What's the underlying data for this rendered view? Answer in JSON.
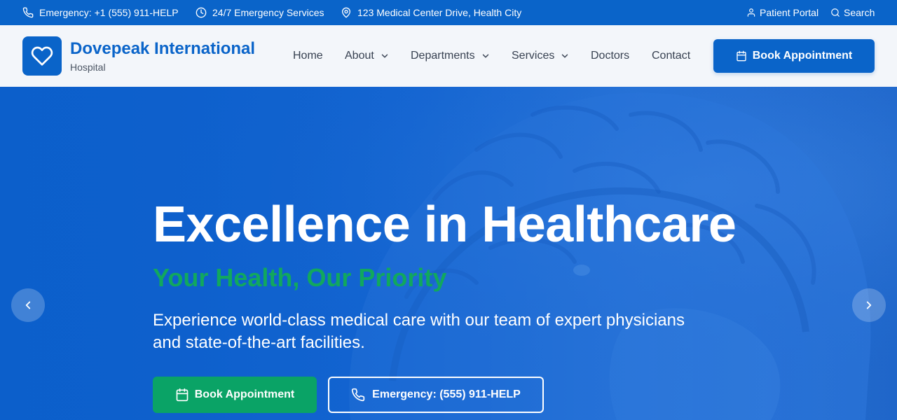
{
  "colors": {
    "primary": "#0a64c9",
    "accent_green": "#0aa366",
    "tagline_green": "#11a85e"
  },
  "topbar": {
    "emergency": {
      "icon": "phone-icon",
      "text": "Emergency: +1 (555) 911-HELP"
    },
    "hours": {
      "icon": "clock-icon",
      "text": "24/7 Emergency Services"
    },
    "address": {
      "icon": "map-pin-icon",
      "text": "123 Medical Center Drive, Health City"
    },
    "patient_portal": {
      "icon": "user-icon",
      "text": "Patient Portal"
    },
    "search": {
      "icon": "search-icon",
      "text": "Search"
    }
  },
  "header": {
    "logo_icon": "heart-icon",
    "brand_name": "Dovepeak International",
    "brand_sub": "Hospital",
    "nav": [
      {
        "label": "Home",
        "dropdown": false
      },
      {
        "label": "About",
        "dropdown": true
      },
      {
        "label": "Departments",
        "dropdown": true
      },
      {
        "label": "Services",
        "dropdown": true
      },
      {
        "label": "Doctors",
        "dropdown": false
      },
      {
        "label": "Contact",
        "dropdown": false
      }
    ],
    "book_button": {
      "icon": "calendar-icon",
      "label": "Book Appointment"
    }
  },
  "hero": {
    "title": "Excellence in Healthcare",
    "tagline": "Your Health, Our Priority",
    "description": "Experience world-class medical care with our team of expert physicians and state-of-the-art facilities.",
    "primary_cta": {
      "icon": "calendar-icon",
      "label": "Book Appointment"
    },
    "secondary_cta": {
      "icon": "phone-icon",
      "label": "Emergency: (555) 911-HELP"
    },
    "prev_icon": "chevron-left-icon",
    "next_icon": "chevron-right-icon",
    "background_image": "brain-model-image"
  }
}
